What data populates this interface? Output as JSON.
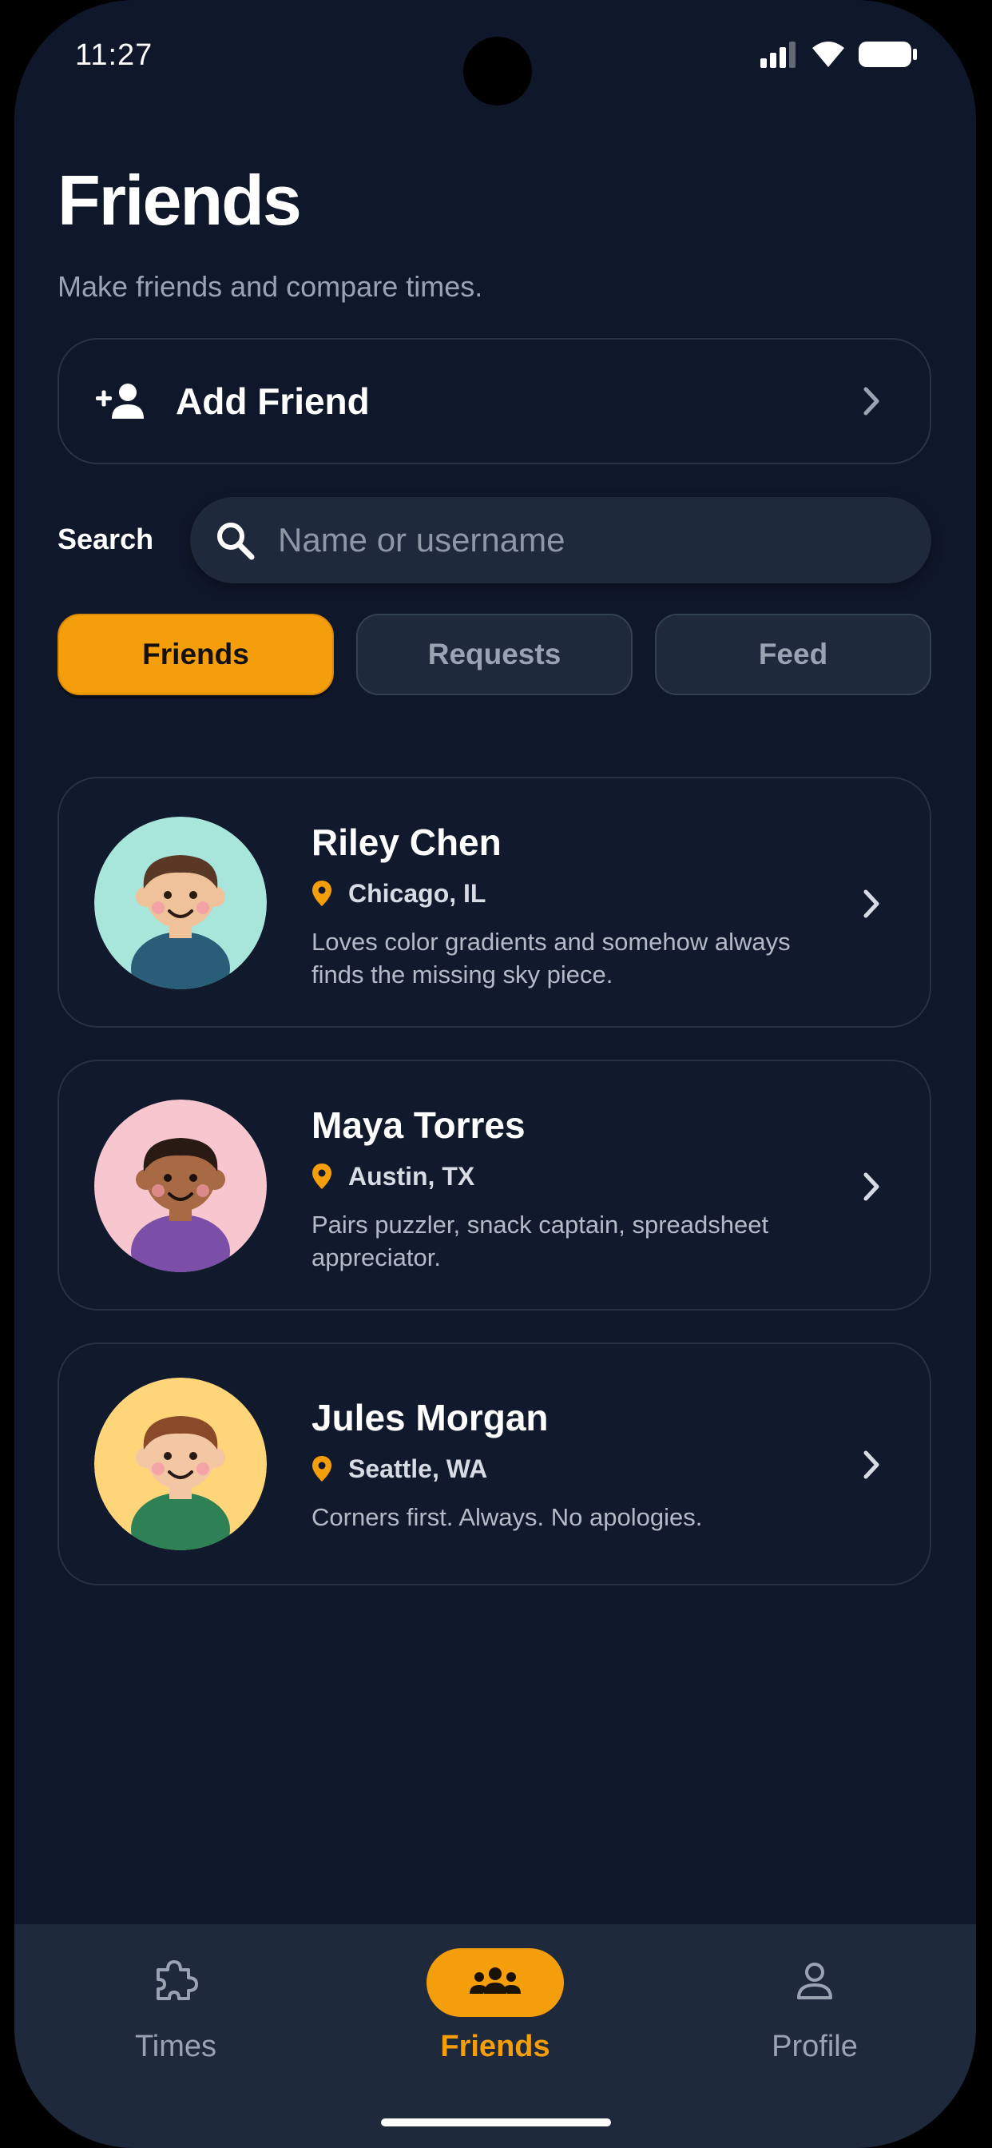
{
  "status_bar": {
    "time": "11:27",
    "icons": [
      "signal-icon",
      "wifi-icon",
      "battery-icon"
    ]
  },
  "header": {
    "title": "Friends",
    "subtitle": "Make friends and compare times."
  },
  "add_friend": {
    "icon": "person-add-icon",
    "label": "Add Friend",
    "chevron": "chevron-right-icon"
  },
  "search": {
    "label": "Search",
    "icon": "search-icon",
    "placeholder": "Name or username",
    "value": ""
  },
  "tabs": [
    {
      "label": "Friends",
      "active": true
    },
    {
      "label": "Requests",
      "active": false
    },
    {
      "label": "Feed",
      "active": false
    }
  ],
  "friends": [
    {
      "name": "Riley Chen",
      "location": "Chicago, IL",
      "bio": "Loves color gradients and somehow always finds the missing sky piece.",
      "avatar_bg": "#a8e6dc",
      "hair": "#5a3825",
      "skin": "#f0c29a",
      "shirt": "#2a5d78"
    },
    {
      "name": "Maya Torres",
      "location": "Austin, TX",
      "bio": "Pairs puzzler, snack captain, spreadsheet appreciator.",
      "avatar_bg": "#f7c6cf",
      "hair": "#2a1a14",
      "skin": "#a86a45",
      "shirt": "#7b4fa8"
    },
    {
      "name": "Jules Morgan",
      "location": "Seattle, WA",
      "bio": "Corners first. Always. No apologies.",
      "avatar_bg": "#ffd57a",
      "hair": "#8a4a2a",
      "skin": "#f3c7a3",
      "shirt": "#2e8055"
    }
  ],
  "bottom_nav": [
    {
      "label": "Times",
      "icon": "puzzle-icon",
      "active": false
    },
    {
      "label": "Friends",
      "icon": "group-icon",
      "active": true
    },
    {
      "label": "Profile",
      "icon": "person-icon",
      "active": false
    }
  ],
  "colors": {
    "background": "#0f172a",
    "accent": "#f59e0b",
    "surface": "#1e293b"
  }
}
